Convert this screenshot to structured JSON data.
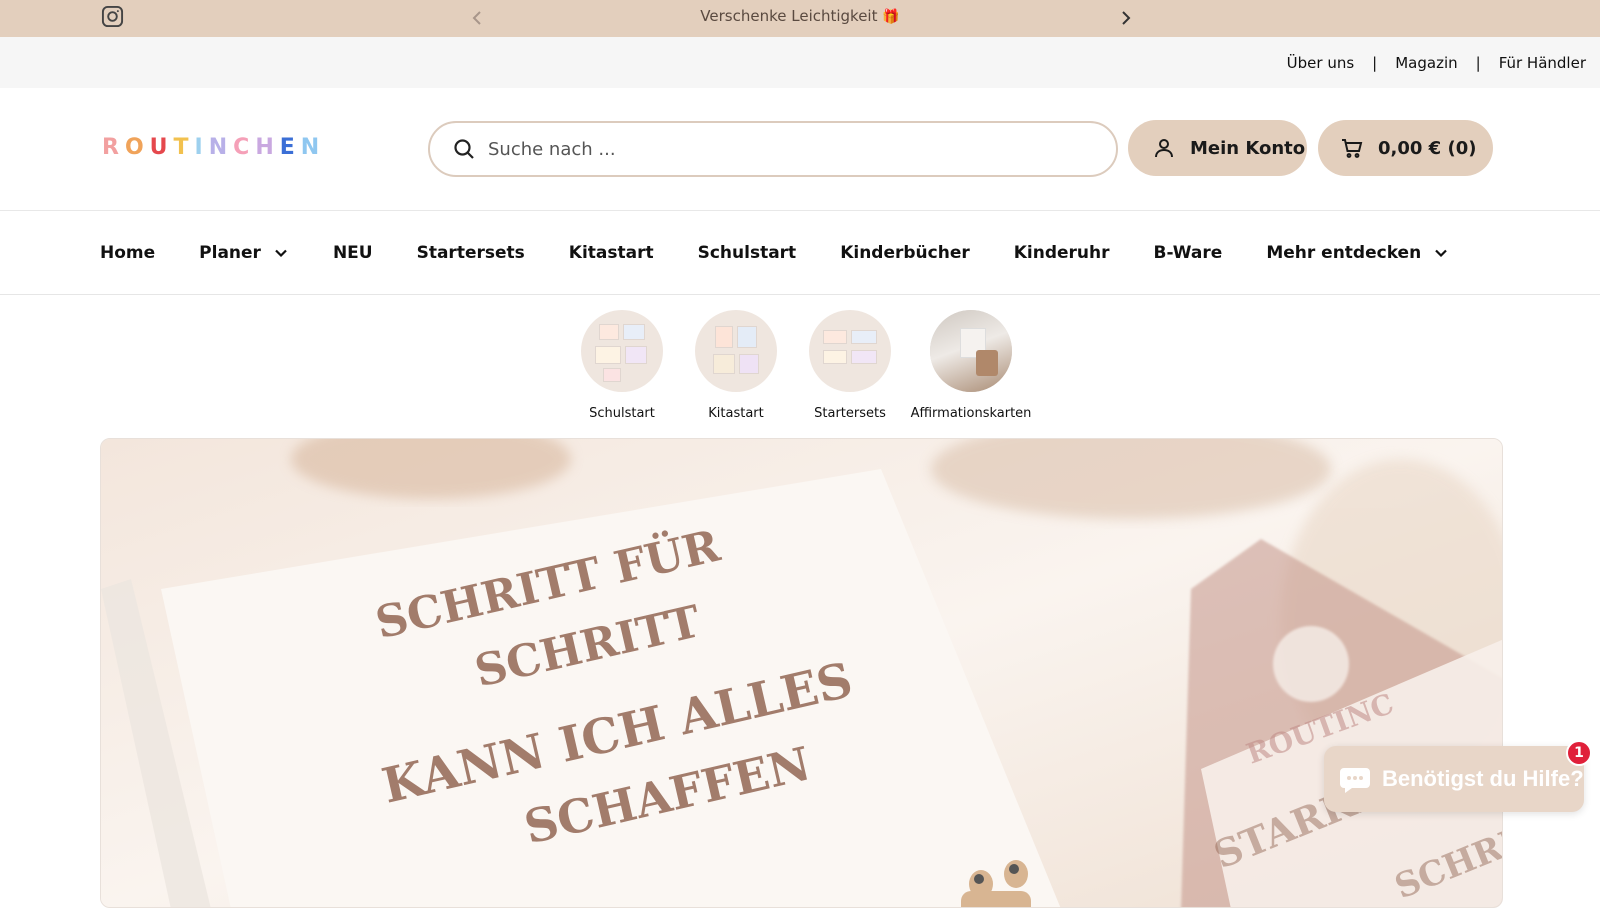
{
  "announcement": {
    "message": "Verschenke Leichtigkeit",
    "emoji": "🎁"
  },
  "secondary_links": [
    "Über uns",
    "Magazin",
    "Für Händler"
  ],
  "secondary_separator": "|",
  "header": {
    "logo_text": [
      "R",
      "O",
      "U",
      "T",
      "I",
      "N",
      "C",
      "H",
      "E",
      "N"
    ],
    "logo_colors": [
      "#f2a0a0",
      "#f0a35a",
      "#e5484d",
      "#f2c14e",
      "#9dd0ee",
      "#b8b0e8",
      "#f5a0b8",
      "#c9a8e0",
      "#3b6fd6",
      "#8fc7f0"
    ],
    "search_placeholder": "Suche nach ...",
    "account_label": "Mein Konto",
    "cart_label": "0,00 € (0)"
  },
  "nav": [
    {
      "label": "Home",
      "has_dropdown": false
    },
    {
      "label": "Planer",
      "has_dropdown": true
    },
    {
      "label": "NEU",
      "has_dropdown": false
    },
    {
      "label": "Startersets",
      "has_dropdown": false
    },
    {
      "label": "Kitastart",
      "has_dropdown": false
    },
    {
      "label": "Schulstart",
      "has_dropdown": false
    },
    {
      "label": "Kinderbücher",
      "has_dropdown": false
    },
    {
      "label": "Kinderuhr",
      "has_dropdown": false
    },
    {
      "label": "B-Ware",
      "has_dropdown": false
    },
    {
      "label": "Mehr entdecken",
      "has_dropdown": true
    }
  ],
  "categories": [
    {
      "label": "Schulstart"
    },
    {
      "label": "Kitastart"
    },
    {
      "label": "Startersets"
    },
    {
      "label": "Affirmationskarten"
    }
  ],
  "hero": {
    "headline_lines": [
      "SCHRITT FÜR",
      "SCHRITT",
      "KANN ICH ALLES",
      "SCHAFFEN"
    ],
    "side_text_lines": [
      "ROUTINC",
      "STARKE",
      "SCHRIT"
    ]
  },
  "chat": {
    "label": "Benötigst du Hilfe?",
    "badge_count": "1"
  },
  "colors": {
    "accent": "#e3cfbd",
    "announcement_bg": "#e3cfbd",
    "badge": "#e0203a"
  }
}
